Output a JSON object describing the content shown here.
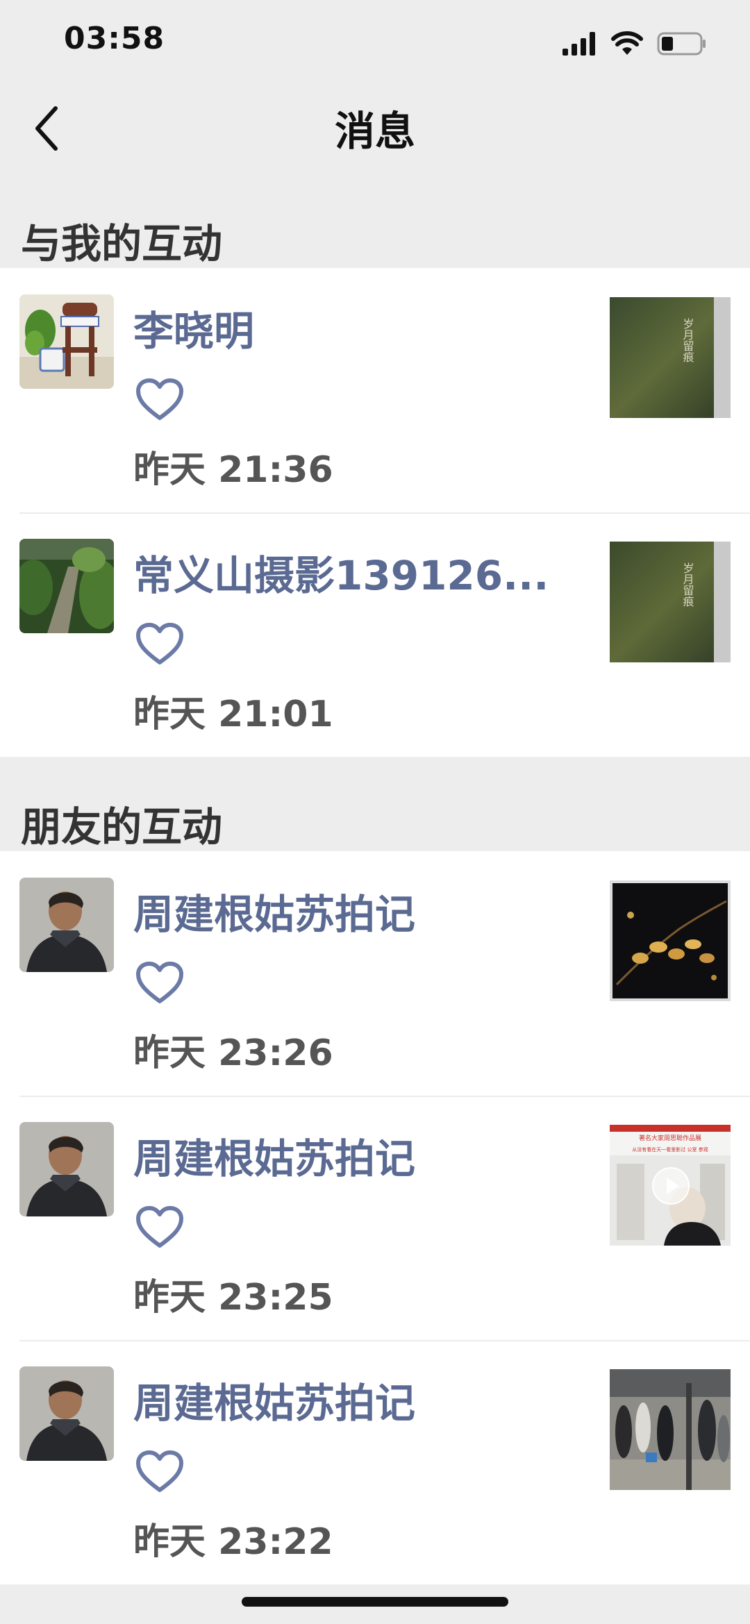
{
  "status": {
    "time": "03:58"
  },
  "nav": {
    "title": "消息"
  },
  "sections": [
    {
      "title": "与我的互动",
      "items": [
        {
          "name": "李晓明",
          "time": "昨天 21:36",
          "thumb_text": "岁月留痕"
        },
        {
          "name": "常义山摄影139126...",
          "time": "昨天 21:01",
          "thumb_text": "岁月留痕"
        }
      ]
    },
    {
      "title": "朋友的互动",
      "items": [
        {
          "name": "周建根姑苏拍记",
          "time": "昨天 23:26"
        },
        {
          "name": "周建根姑苏拍记",
          "time": "昨天 23:25",
          "thumb_text_1": "著名大家周思聪作品展",
          "thumb_text_2": "从没有看在天一看里影过 公室 参观"
        },
        {
          "name": "周建根姑苏拍记",
          "time": "昨天 23:22"
        }
      ]
    }
  ],
  "colors": {
    "name": "#5b6a92",
    "heart": "#6b7aa6",
    "background": "#ededed"
  },
  "icons": [
    "back-chevron-icon",
    "signal-icon",
    "wifi-icon",
    "battery-icon",
    "heart-icon"
  ]
}
